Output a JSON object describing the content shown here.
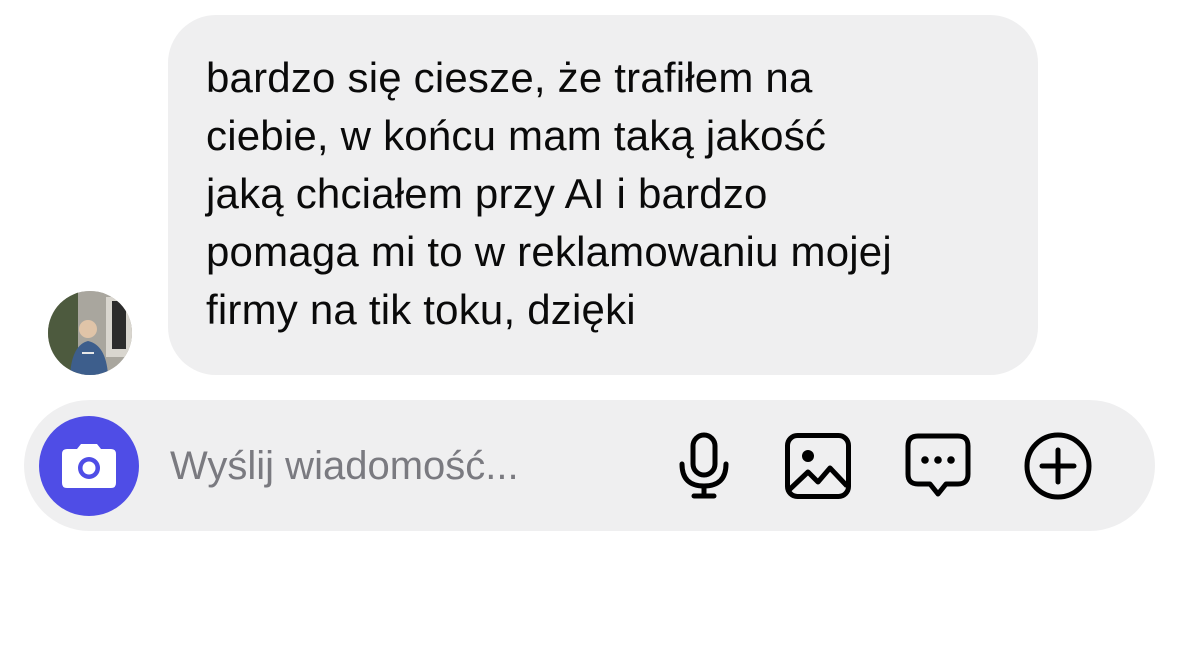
{
  "conversation": {
    "incoming_message": {
      "text": "bardzo się ciesze, że trafiłem na\nciebie, w końcu mam taką jakość\njaką chciałem przy AI i bardzo\npomaga mi to w reklamowaniu mojej\nfirmy na tik toku, dzięki"
    }
  },
  "composer": {
    "placeholder": "Wyślij wiadomość...",
    "value": "",
    "icons": [
      "camera-icon",
      "microphone-icon",
      "gallery-icon",
      "chat-bubble-icon",
      "plus-circle-icon"
    ]
  },
  "colors": {
    "accent": "#4f4de6",
    "bubble_bg": "#efeff0",
    "composer_bg": "#efeff0",
    "placeholder_text": "#7a7a80"
  }
}
